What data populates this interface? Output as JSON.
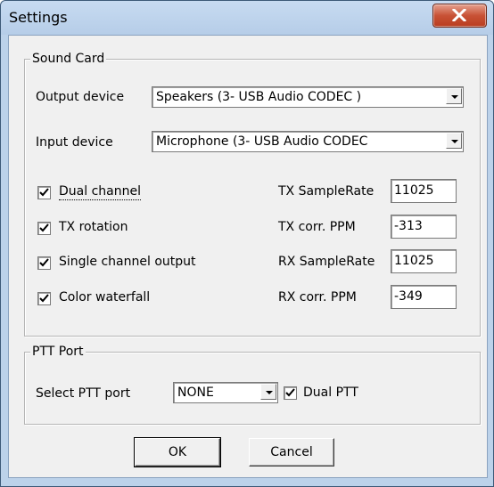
{
  "window": {
    "title": "Settings",
    "close_label": "X"
  },
  "sound_card": {
    "legend": "Sound Card",
    "output_device_label": "Output device",
    "output_device_value": "Speakers (3- USB Audio CODEC )",
    "input_device_label": "Input device",
    "input_device_value": "Microphone (3- USB Audio CODEC",
    "checkboxes": [
      {
        "label": "Dual channel",
        "checked": true
      },
      {
        "label": "TX rotation",
        "checked": true
      },
      {
        "label": "Single channel output",
        "checked": true
      },
      {
        "label": "Color waterfall",
        "checked": true
      }
    ],
    "fields": [
      {
        "label": "TX SampleRate",
        "value": "11025"
      },
      {
        "label": "TX corr. PPM",
        "value": "-313"
      },
      {
        "label": "RX SampleRate",
        "value": "11025"
      },
      {
        "label": "RX corr. PPM",
        "value": "-349"
      }
    ]
  },
  "ptt_port": {
    "legend": "PTT Port",
    "select_label": "Select PTT port",
    "select_value": "NONE",
    "dual_ptt_label": "Dual PTT",
    "dual_ptt_checked": true
  },
  "buttons": {
    "ok": "OK",
    "cancel": "Cancel"
  }
}
